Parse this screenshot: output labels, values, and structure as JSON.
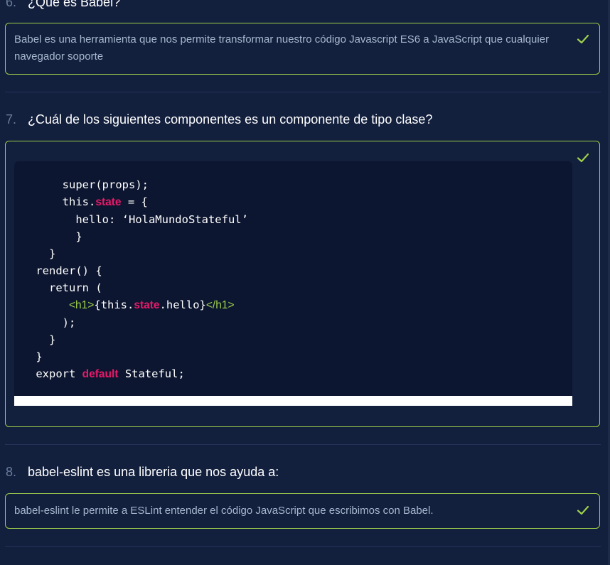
{
  "colors": {
    "background": "#121f3d",
    "accent": "#9ed04a",
    "keyword": "#e8196a",
    "muted": "#6b7c9c"
  },
  "questions": [
    {
      "number": "6.",
      "text": "¿Qué es Babel?",
      "answer": "Babel es una herramienta que nos permite transformar nuestro código Javascript ES6 a JavaScript que cualquier navegador soporte",
      "answer_icon": "check-icon"
    },
    {
      "number": "7.",
      "text": "¿Cuál de los siguientes componentes es un componente de tipo clase?",
      "answer_icon": "check-icon",
      "code": {
        "l1_indent": "     ",
        "l1": "super(props);",
        "l2_indent": "     ",
        "l2_a": "this.",
        "l2_kw": "state",
        "l2_b": " = {",
        "l3_indent": "       ",
        "l3": "hello: ‘HolaMundoStateful’",
        "l4_indent": "       ",
        "l4": "}",
        "l5_indent": "   ",
        "l5": "}",
        "l6_indent": " ",
        "l6": "render() {",
        "l7_indent": "   ",
        "l7": "return (",
        "l8_indent": "      ",
        "l8_tag_open": "<h1>",
        "l8_a": "{this.",
        "l8_kw": "state",
        "l8_b": ".hello}",
        "l8_tag_close": "</h1>",
        "l9_indent": "     ",
        "l9": ");",
        "l10_indent": "   ",
        "l10": "}",
        "l11_indent": " ",
        "l11": "}",
        "l12_indent": " ",
        "l12_a": "export ",
        "l12_kw": "default",
        "l12_b": " Stateful;"
      }
    },
    {
      "number": "8.",
      "text": "babel-eslint es una libreria que nos ayuda a:",
      "answer": "babel-eslint le permite a ESLint entender el código JavaScript que escribimos con Babel.",
      "answer_icon": "check-icon"
    }
  ]
}
